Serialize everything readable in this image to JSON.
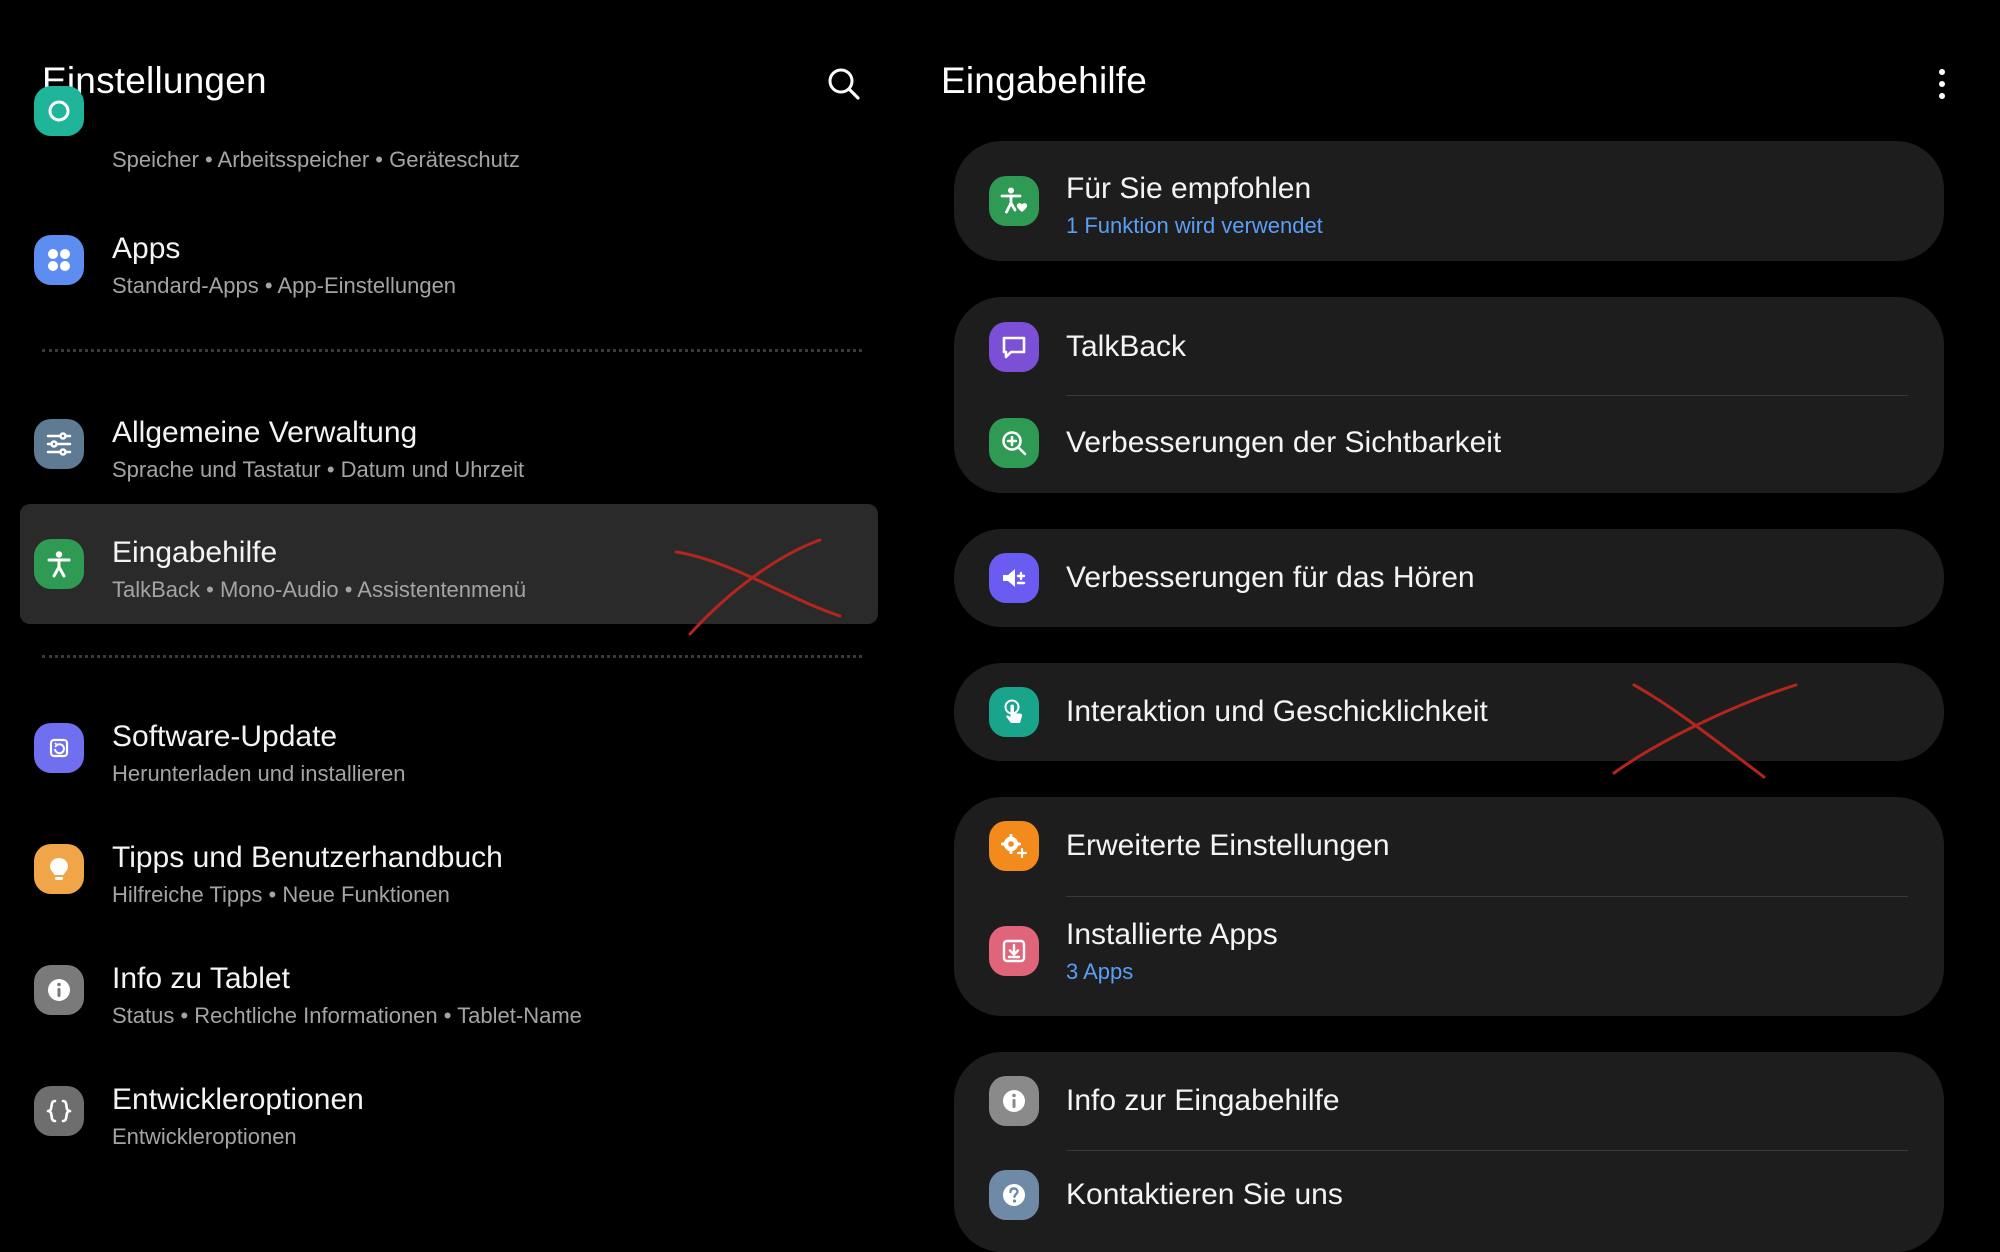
{
  "left": {
    "title": "Einstellungen",
    "search_icon": "search-icon",
    "items": [
      {
        "name": "device-care",
        "title": "",
        "subtitle": "Speicher  •  Arbeitsspeicher  •  Geräteschutz",
        "color": "#1fb59a",
        "icon": "device-care-icon"
      },
      {
        "name": "apps",
        "title": "Apps",
        "subtitle": "Standard-Apps  •  App-Einstellungen",
        "color": "#5d8df0",
        "icon": "apps-icon"
      },
      {
        "name": "general-management",
        "title": "Allgemeine Verwaltung",
        "subtitle": "Sprache und Tastatur  •  Datum und Uhrzeit",
        "color": "#5f7a93",
        "icon": "sliders-icon"
      },
      {
        "name": "accessibility",
        "title": "Eingabehilfe",
        "subtitle": "TalkBack  •  Mono-Audio  •  Assistentenmenü",
        "color": "#2e9a53",
        "icon": "accessibility-icon"
      },
      {
        "name": "software-update",
        "title": "Software-Update",
        "subtitle": "Herunterladen und installieren",
        "color": "#6f6ff0",
        "icon": "update-icon"
      },
      {
        "name": "tips",
        "title": "Tipps und Benutzerhandbuch",
        "subtitle": "Hilfreiche Tipps  •  Neue Funktionen",
        "color": "#f0a648",
        "icon": "lightbulb-icon"
      },
      {
        "name": "about-tablet",
        "title": "Info zu Tablet",
        "subtitle": "Status  •  Rechtliche Informationen  •  Tablet-Name",
        "color": "#7a7a7a",
        "icon": "info-icon"
      },
      {
        "name": "developer-options",
        "title": "Entwickleroptionen",
        "subtitle": "Entwickleroptionen",
        "color": "#6e6e6e",
        "icon": "braces-icon"
      }
    ]
  },
  "right": {
    "title": "Eingabehilfe",
    "more_icon": "more-vertical-icon",
    "cards": [
      {
        "items": [
          {
            "name": "recommended",
            "title": "Für Sie empfohlen",
            "subtitle": "1 Funktion wird verwendet",
            "color": "#2e9a53",
            "icon": "accessibility-heart-icon"
          }
        ]
      },
      {
        "items": [
          {
            "name": "talkback",
            "title": "TalkBack",
            "subtitle": "",
            "color": "#7b4fd6",
            "icon": "chat-bubble-icon"
          },
          {
            "name": "visibility",
            "title": "Verbesserungen der Sichtbarkeit",
            "subtitle": "",
            "color": "#2e9a53",
            "icon": "zoom-in-icon"
          }
        ]
      },
      {
        "items": [
          {
            "name": "hearing",
            "title": "Verbesserungen für das Hören",
            "subtitle": "",
            "color": "#6a5cf0",
            "icon": "speaker-plus-icon"
          }
        ]
      },
      {
        "items": [
          {
            "name": "interaction",
            "title": "Interaktion und Geschicklichkeit",
            "subtitle": "",
            "color": "#19a58c",
            "icon": "touch-icon"
          }
        ]
      },
      {
        "items": [
          {
            "name": "advanced",
            "title": "Erweiterte Einstellungen",
            "subtitle": "",
            "color": "#f28a1c",
            "icon": "gear-plus-icon"
          },
          {
            "name": "installed-apps",
            "title": "Installierte Apps",
            "subtitle": "3 Apps",
            "color": "#e0647a",
            "icon": "download-icon"
          }
        ]
      },
      {
        "items": [
          {
            "name": "about-accessibility",
            "title": "Info zur Eingabehilfe",
            "subtitle": "",
            "color": "#8a8a8a",
            "icon": "info-icon"
          },
          {
            "name": "contact",
            "title": "Kontaktieren Sie uns",
            "subtitle": "",
            "color": "#6f8aa6",
            "icon": "question-icon"
          }
        ]
      }
    ]
  },
  "annotation": {
    "mark": "red-x-mark-icon",
    "color": "#b3261e"
  }
}
